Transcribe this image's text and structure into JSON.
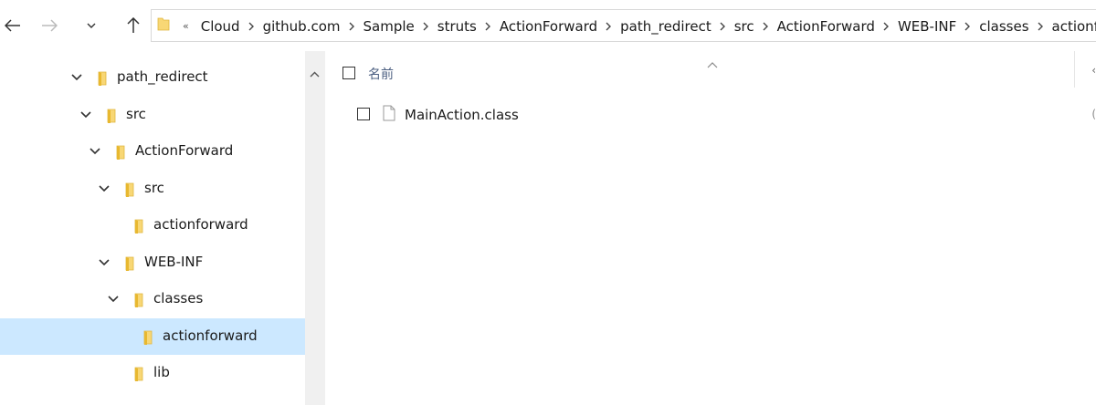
{
  "nav": {
    "back_icon": "arrow-left-icon",
    "forward_icon": "arrow-right-icon",
    "recent_icon": "chevron-down-icon",
    "up_icon": "arrow-up-icon"
  },
  "address": {
    "overflow": "«",
    "crumbs": [
      "Cloud",
      "github.com",
      "Sample",
      "struts",
      "ActionForward",
      "path_redirect",
      "src",
      "ActionForward",
      "WEB-INF",
      "classes",
      "actionforward"
    ]
  },
  "tree": {
    "items": [
      {
        "label": "path_redirect",
        "expanded": true
      },
      {
        "label": "src",
        "expanded": true
      },
      {
        "label": "ActionForward",
        "expanded": true
      },
      {
        "label": "src",
        "expanded": true
      },
      {
        "label": "actionforward",
        "expanded": false
      },
      {
        "label": "WEB-INF",
        "expanded": true
      },
      {
        "label": "classes",
        "expanded": true
      },
      {
        "label": "actionforward",
        "expanded": false,
        "selected": true
      },
      {
        "label": "lib",
        "expanded": false
      }
    ]
  },
  "content": {
    "column_name": "名前",
    "files": [
      {
        "name": "MainAction.class",
        "icon": "file-icon"
      }
    ],
    "edge_header": "‹",
    "edge_value": "("
  },
  "colors": {
    "selection": "#cce8ff",
    "folder": "#f8d775",
    "header_text": "#4d6082"
  }
}
